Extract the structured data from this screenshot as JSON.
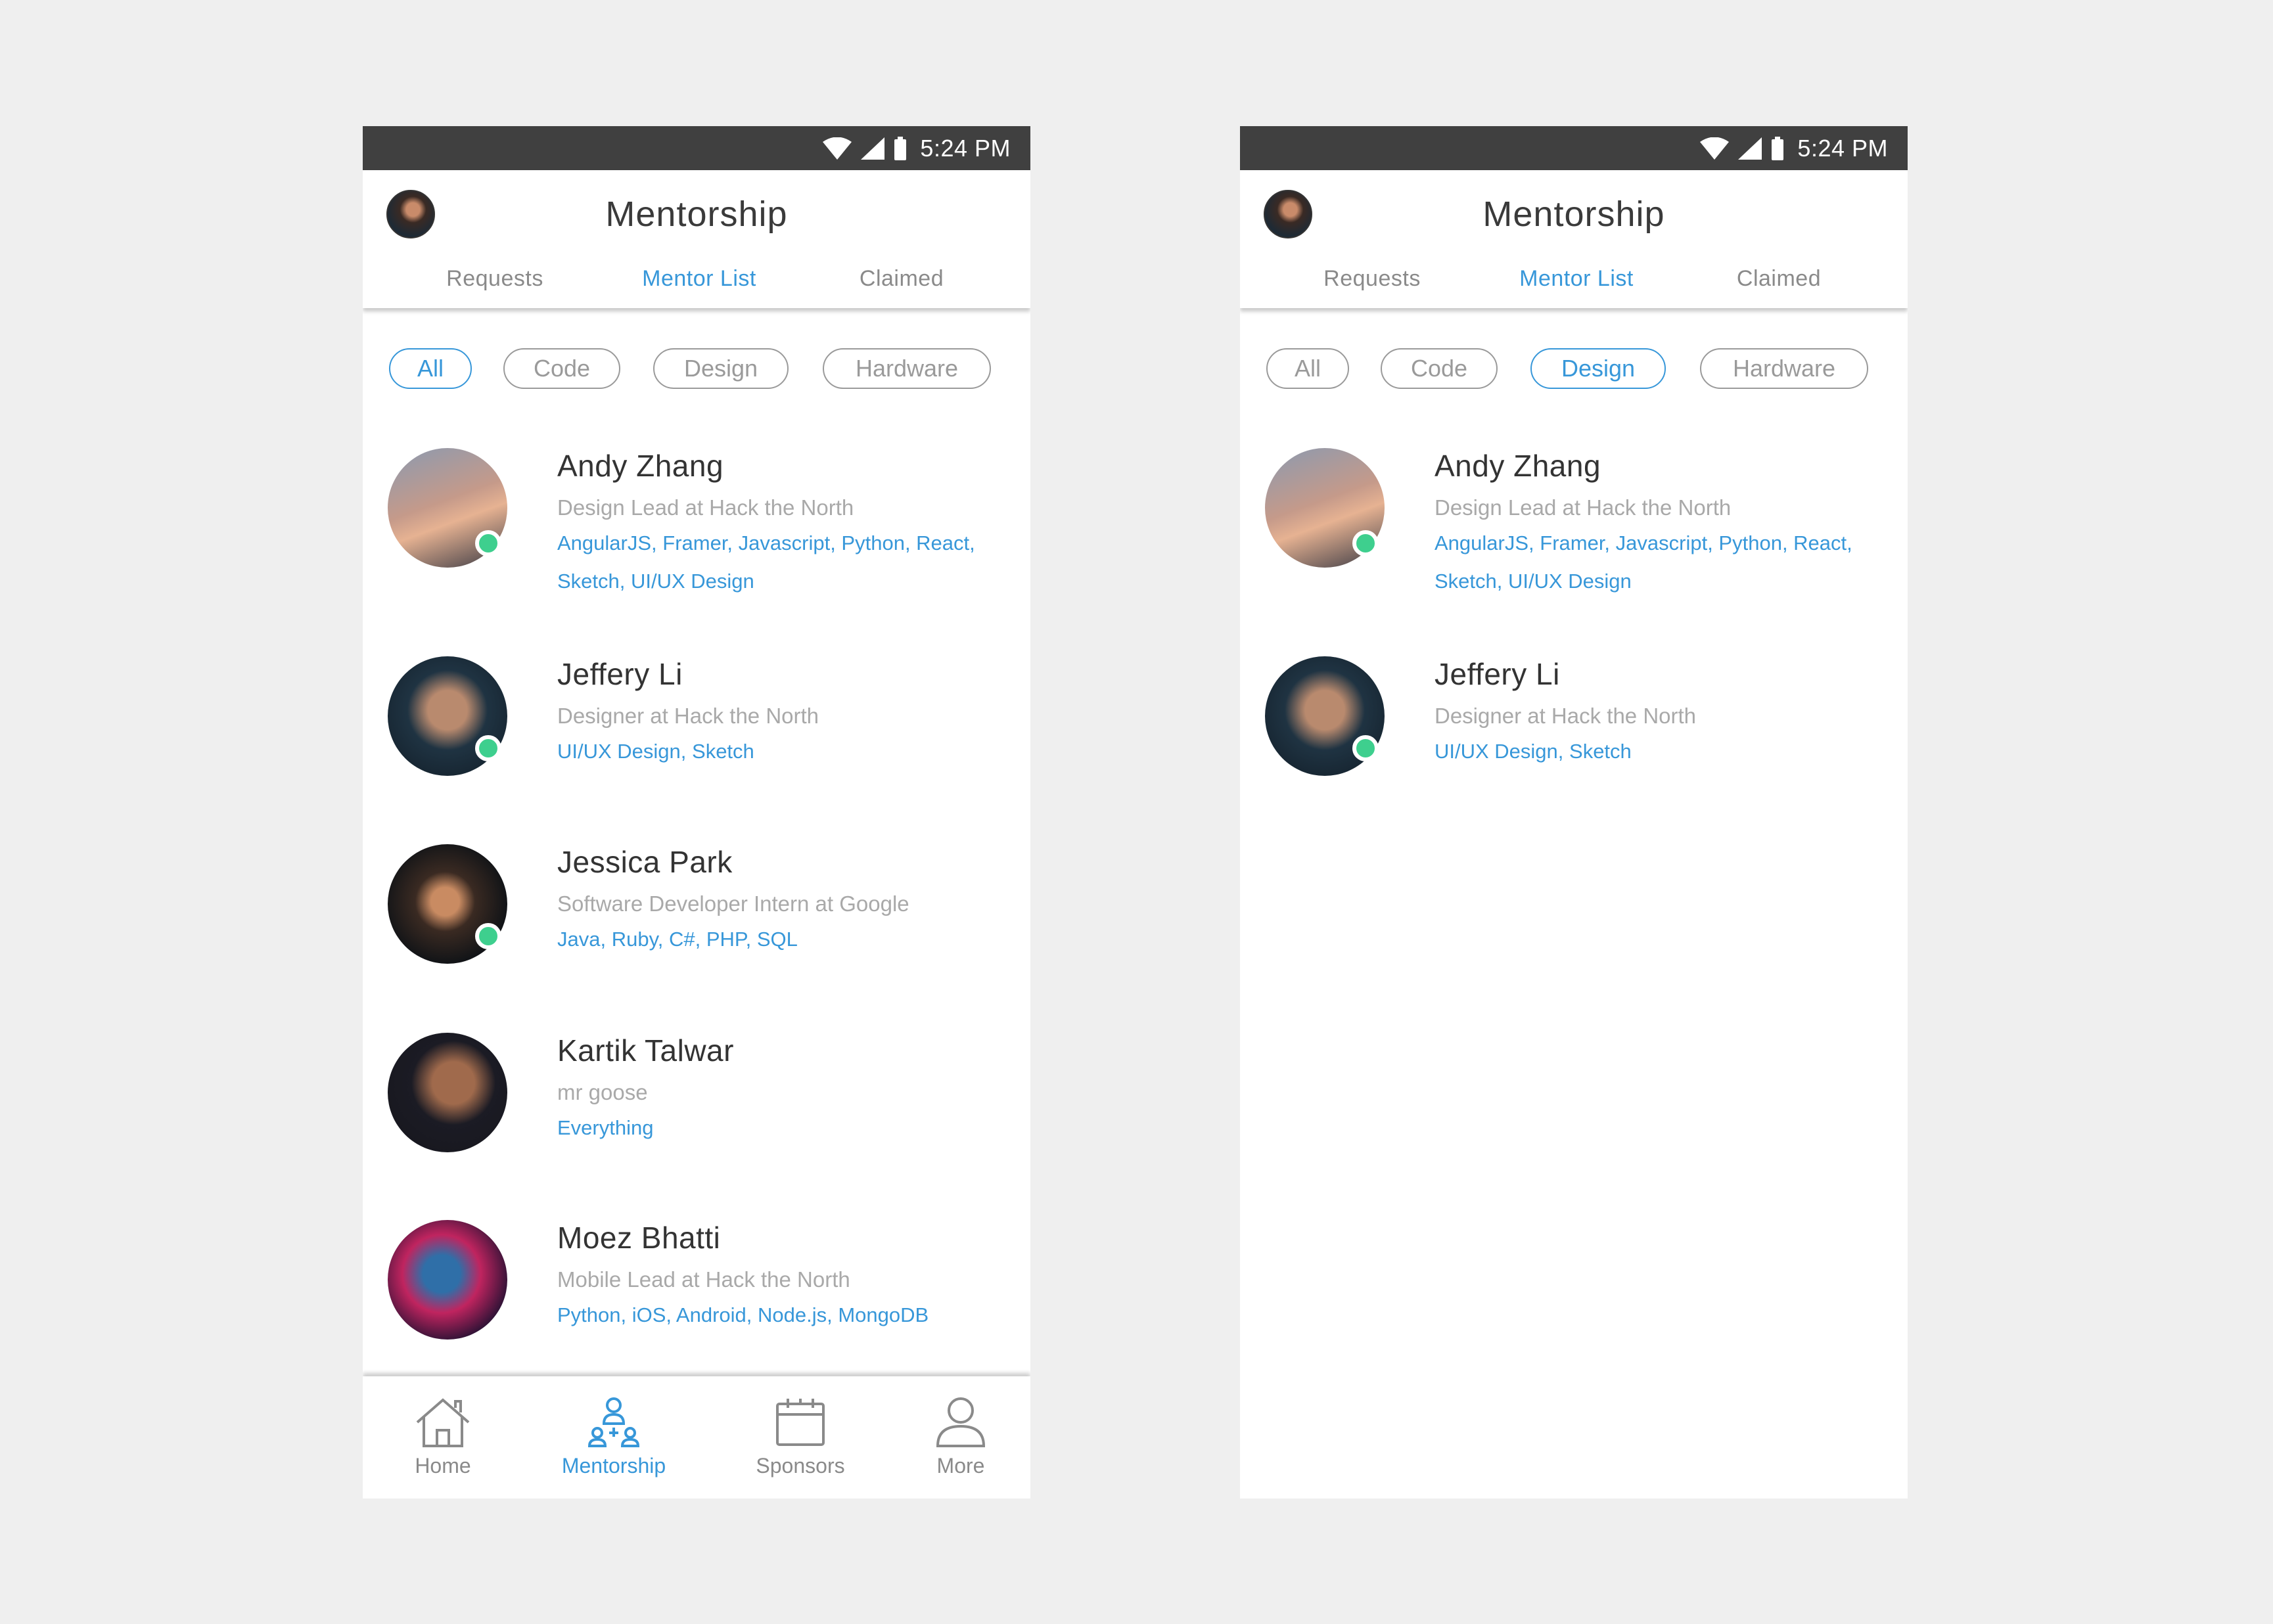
{
  "status_bar": {
    "time": "5:24 PM"
  },
  "app": {
    "title": "Mentorship"
  },
  "tabs": [
    {
      "label": "Requests"
    },
    {
      "label": "Mentor List"
    },
    {
      "label": "Claimed"
    }
  ],
  "filters": [
    "All",
    "Code",
    "Design",
    "Hardware"
  ],
  "screens": [
    {
      "active_filter": "All"
    },
    {
      "active_filter": "Design"
    }
  ],
  "mentors": [
    {
      "name": "Andy Zhang",
      "role": "Design Lead at Hack the North",
      "skills": "AngularJS, Framer, Javascript, Python, React, Sketch, UI/UX Design",
      "online": true
    },
    {
      "name": "Jeffery Li",
      "role": "Designer at Hack the North",
      "skills": "UI/UX Design, Sketch",
      "online": true
    },
    {
      "name": "Jessica Park",
      "role": "Software Developer Intern at Google",
      "skills": "Java, Ruby, C#, PHP, SQL",
      "online": true
    },
    {
      "name": "Kartik Talwar",
      "role": "mr goose",
      "skills": "Everything",
      "online": false
    },
    {
      "name": "Moez Bhatti",
      "role": "Mobile Lead at Hack the North",
      "skills": "Python, iOS, Android, Node.js, MongoDB",
      "online": false
    }
  ],
  "bottom_nav": [
    {
      "label": "Home",
      "icon": "home-icon"
    },
    {
      "label": "Mentorship",
      "icon": "mentorship-icon"
    },
    {
      "label": "Sponsors",
      "icon": "calendar-icon"
    },
    {
      "label": "More",
      "icon": "person-icon"
    }
  ],
  "colors": {
    "accent": "#3797d9",
    "online": "#3ecf8e",
    "status_bar": "#404040"
  }
}
